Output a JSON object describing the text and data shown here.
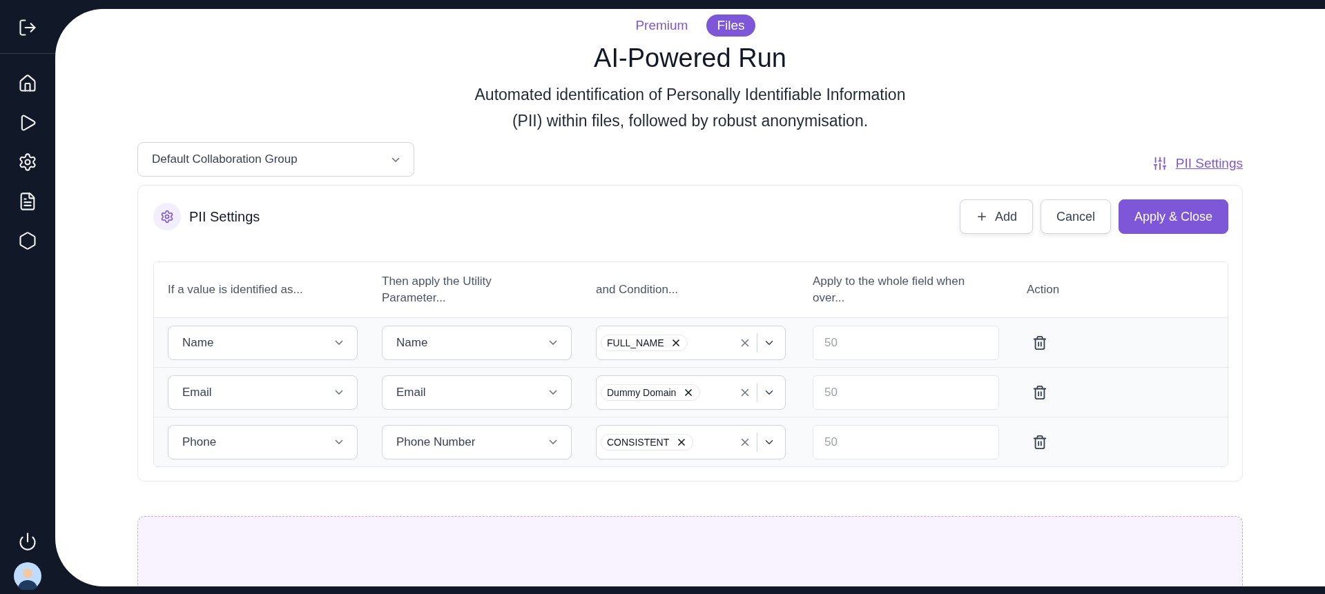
{
  "sidebar": {
    "items": [
      {
        "selected": false
      },
      {
        "selected": false
      },
      {
        "selected": false
      },
      {
        "selected": false
      },
      {
        "selected": false
      },
      {
        "selected": false
      }
    ]
  },
  "tabs": [
    {
      "label": "Premium",
      "selected": false
    },
    {
      "label": "Files",
      "selected": true
    }
  ],
  "title": "AI-Powered Run",
  "subtitle": [
    "Automated identification of Personally Identifiable Information",
    "(PII) within files, followed by robust anonymisation."
  ],
  "group_select": {
    "value": "Default Collaboration Group"
  },
  "settings_link": "PII Settings",
  "panel": {
    "title": "PII Settings",
    "buttons": [
      {
        "label": "Add",
        "kind": "add"
      },
      {
        "label": "Cancel",
        "kind": "secondary"
      },
      {
        "label": "Apply & Close",
        "kind": "primary"
      }
    ]
  },
  "table": {
    "columns": [
      "If a value is identified as...",
      "Then apply the Utility Parameter...",
      "and Condition...",
      "Apply to the whole field when over...",
      "Action"
    ],
    "rows": [
      {
        "identified": "Name",
        "parameter": "Name",
        "conditions": [
          "FULL_NAME"
        ],
        "threshold": "50"
      },
      {
        "identified": "Email",
        "parameter": "Email",
        "conditions": [
          "Dummy Domain"
        ],
        "threshold": "50"
      },
      {
        "identified": "Phone",
        "parameter": "Phone Number",
        "conditions": [
          "CONSISTENT"
        ],
        "threshold": "50"
      }
    ]
  }
}
